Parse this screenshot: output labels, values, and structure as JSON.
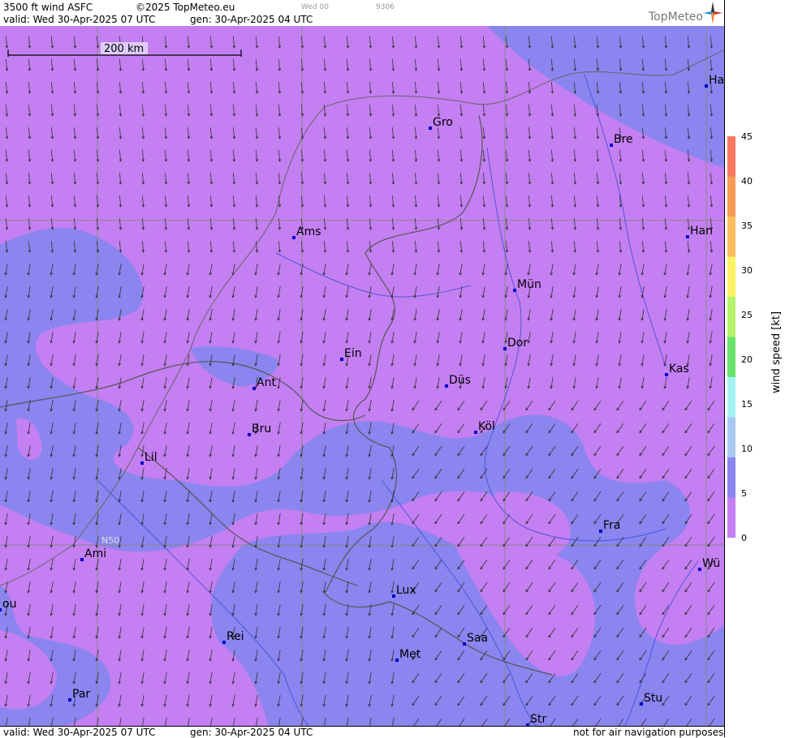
{
  "header": {
    "product": "3500 ft wind ASFC",
    "copyright": "©2025 TopMeteo.eu",
    "slot": "Wed 00",
    "code": "9306",
    "valid": "valid:  Wed  30-Apr-2025  07 UTC",
    "gen": "gen: 30-Apr-2025 04 UTC",
    "brand": "TopMeteo"
  },
  "scale_bar": {
    "label": "200 km"
  },
  "grid_label": "N50",
  "cities": [
    {
      "name": "Ha"
    },
    {
      "name": "Gro"
    },
    {
      "name": "Bre"
    },
    {
      "name": "Ams"
    },
    {
      "name": "Han"
    },
    {
      "name": "Mün"
    },
    {
      "name": "Ein"
    },
    {
      "name": "Dor"
    },
    {
      "name": "Ant"
    },
    {
      "name": "Düs"
    },
    {
      "name": "Kas"
    },
    {
      "name": "Bru"
    },
    {
      "name": "Köl"
    },
    {
      "name": "Lil"
    },
    {
      "name": "Fra"
    },
    {
      "name": "Ami"
    },
    {
      "name": "Wü"
    },
    {
      "name": "Lux"
    },
    {
      "name": "ou"
    },
    {
      "name": "Rei"
    },
    {
      "name": "Saa"
    },
    {
      "name": "Met"
    },
    {
      "name": "Par"
    },
    {
      "name": "Stu"
    },
    {
      "name": "Str"
    }
  ],
  "legend": {
    "title": "wind  speed  [kt]",
    "unit": "kt",
    "ticks": [
      "45",
      "40",
      "35",
      "30",
      "25",
      "20",
      "15",
      "10",
      "5",
      "0"
    ],
    "colors": [
      "#f67860",
      "#f89a58",
      "#fabf5c",
      "#fbf266",
      "#b6f26c",
      "#6ae26a",
      "#a4f2f2",
      "#a8c8f2",
      "#8a85ef",
      "#c47ff2"
    ]
  },
  "footer": {
    "valid": "valid:  Wed  30-Apr-2025  07 UTC",
    "gen": "gen: 30-Apr-2025 04 UTC",
    "disclaimer": "not for air navigation purposes"
  },
  "colors": {
    "wind_0_5": "#c47ff2",
    "wind_5_10": "#8a85ef"
  }
}
